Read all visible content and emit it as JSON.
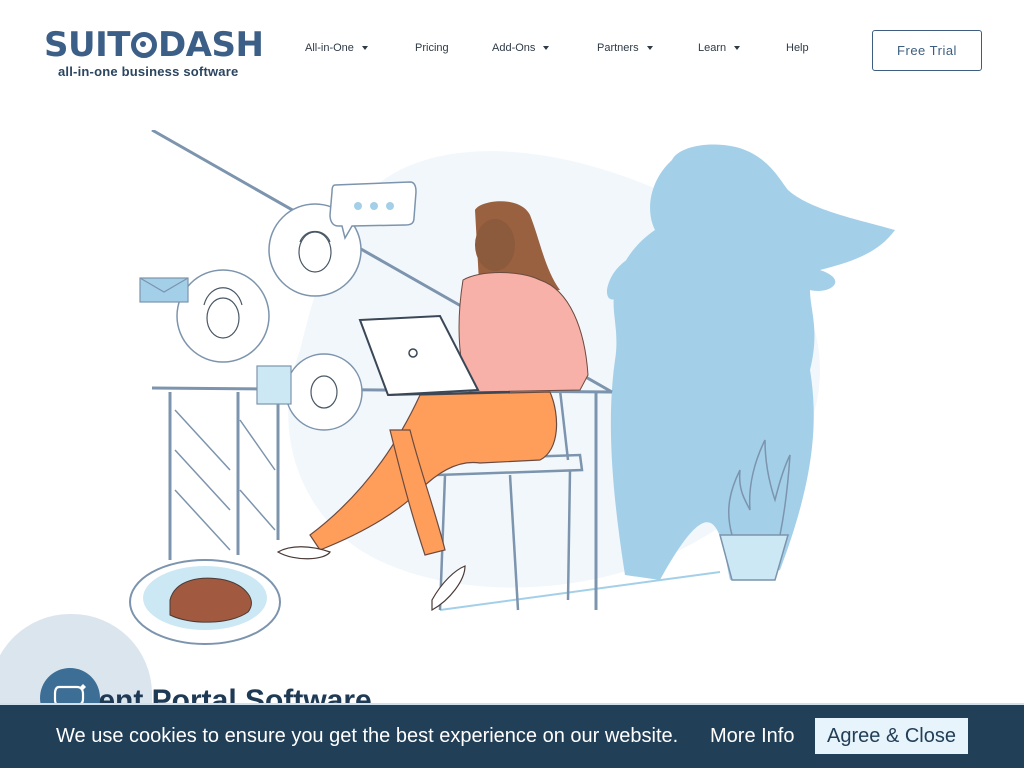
{
  "header": {
    "logo_text_left": "SUIT",
    "logo_text_right": "DASH",
    "logo_tagline": "all-in-one business software",
    "nav": [
      {
        "label": "All-in-One",
        "has_dropdown": true
      },
      {
        "label": "Pricing",
        "has_dropdown": false
      },
      {
        "label": "Add-Ons",
        "has_dropdown": true
      },
      {
        "label": "Partners",
        "has_dropdown": true
      },
      {
        "label": "Learn",
        "has_dropdown": true
      },
      {
        "label": "Help",
        "has_dropdown": false
      }
    ],
    "cta_label": "Free Trial"
  },
  "hero": {
    "illustration": "woman-working-on-laptop-with-superhero-shadow",
    "heading": "Client Portal Software"
  },
  "chat": {
    "icon": "chat-bubble-icon"
  },
  "cookie_banner": {
    "message": "We use cookies to ensure you get the best experience on our website.",
    "more_info_label": "More Info",
    "agree_label": "Agree & Close"
  },
  "colors": {
    "brand": "#3b5f86",
    "banner_bg": "#223f58",
    "accent_light_blue": "#a3d0e8",
    "shirt_pink": "#f7b1a8",
    "pants_orange": "#ff9e5a"
  }
}
